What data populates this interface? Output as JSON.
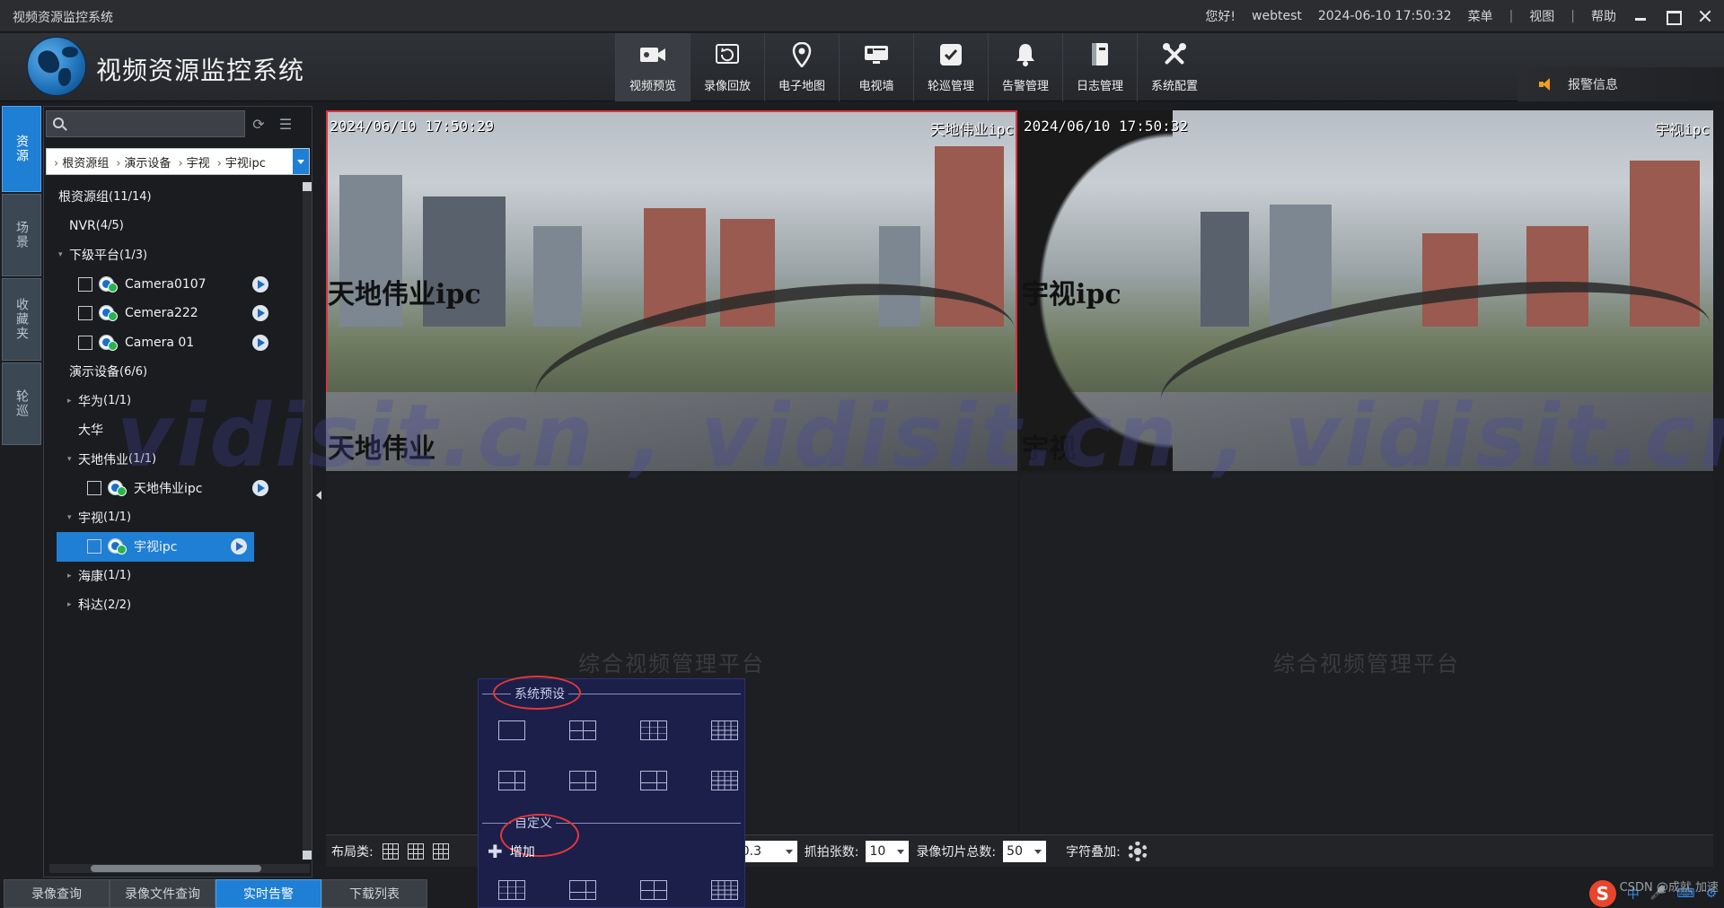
{
  "titlebar": {
    "app_title": "视频资源监控系统",
    "greeting": "您好!",
    "user": "webtest",
    "datetime": "2024-06-10 17:50:32",
    "menus": [
      "菜单",
      "视图",
      "帮助"
    ]
  },
  "header": {
    "brand": "视频资源监控系统",
    "nav": [
      {
        "label": "视频预览",
        "icon": "video-camera-icon",
        "active": true
      },
      {
        "label": "录像回放",
        "icon": "replay-icon"
      },
      {
        "label": "电子地图",
        "icon": "map-pin-icon"
      },
      {
        "label": "电视墙",
        "icon": "tv-wall-icon"
      },
      {
        "label": "轮巡管理",
        "icon": "patrol-check-icon"
      },
      {
        "label": "告警管理",
        "icon": "bell-icon"
      },
      {
        "label": "日志管理",
        "icon": "log-book-icon"
      },
      {
        "label": "系统配置",
        "icon": "tools-icon"
      }
    ],
    "alarm_info": "报警信息"
  },
  "vtabs": [
    {
      "label": "资源",
      "active": true
    },
    {
      "label": "场景"
    },
    {
      "label": "收藏夹"
    },
    {
      "label": "轮巡"
    }
  ],
  "panel": {
    "search_placeholder": "",
    "breadcrumbs": [
      "根资源组",
      "演示设备",
      "宇视",
      "宇视ipc"
    ],
    "tree": [
      {
        "label": "根资源组",
        "count": "(11/14)",
        "level": 0
      },
      {
        "label": "NVR",
        "count": "(4/5)",
        "level": 1
      },
      {
        "label": "下级平台",
        "count": "(1/3)",
        "level": 1,
        "expanded": true
      },
      {
        "label": "Camera0107",
        "level": 2,
        "camera": true
      },
      {
        "label": "Cemera222",
        "level": 2,
        "camera": true
      },
      {
        "label": "Camera 01",
        "level": 2,
        "camera": true
      },
      {
        "label": "演示设备",
        "count": "(6/6)",
        "level": 1
      },
      {
        "label": "华为",
        "count": "(1/1)",
        "level": 2,
        "collapsed": true
      },
      {
        "label": "大华",
        "level": 2
      },
      {
        "label": "天地伟业",
        "count": "(1/1)",
        "level": 2,
        "expanded": true
      },
      {
        "label": "天地伟业ipc",
        "level": 3,
        "camera": true
      },
      {
        "label": "宇视",
        "count": "(1/1)",
        "level": 2,
        "expanded": true
      },
      {
        "label": "宇视ipc",
        "level": 3,
        "camera": true,
        "selected": true
      },
      {
        "label": "海康",
        "count": "(1/1)",
        "level": 2,
        "collapsed": true
      },
      {
        "label": "科达",
        "count": "(2/2)",
        "level": 2,
        "collapsed": true
      }
    ]
  },
  "video": {
    "cell1": {
      "timestamp": "2024/06/10 17:50:29",
      "channel": "天地伟业ipc",
      "overlay_top": "天地伟业ipc",
      "overlay_bottom": "天地伟业"
    },
    "cell2": {
      "timestamp": "2024/06/10 17:50:32",
      "channel": "宇视ipc",
      "overlay_top": "宇视ipc",
      "overlay_bottom": "宇视"
    },
    "empty_watermark": "综合视频管理平台"
  },
  "toolbar": {
    "layout_label": "布局类:",
    "ratio_value": "0.3",
    "snap_label": "抓拍张数:",
    "snap_value": "10",
    "record_label": "录像切片总数:",
    "record_value": "50",
    "overlay_label": "字符叠加:"
  },
  "popup": {
    "preset_title": "系统预设",
    "custom_title": "自定义",
    "add_label": "增加"
  },
  "bottom_tabs": [
    {
      "label": "录像查询"
    },
    {
      "label": "录像文件查询"
    },
    {
      "label": "实时告警",
      "active": true
    },
    {
      "label": "下载列表"
    }
  ],
  "watermark": "vidisit.cn , vidisit.cn , vidisit.cn",
  "tray": {
    "ime": "中",
    "credit": "CSDN @成就 加速"
  },
  "colors": {
    "accent": "#1e7fd4",
    "active_cell_border": "#d8343a",
    "popup_bg": "#1b1f4a",
    "highlight_ring": "#e43838"
  }
}
